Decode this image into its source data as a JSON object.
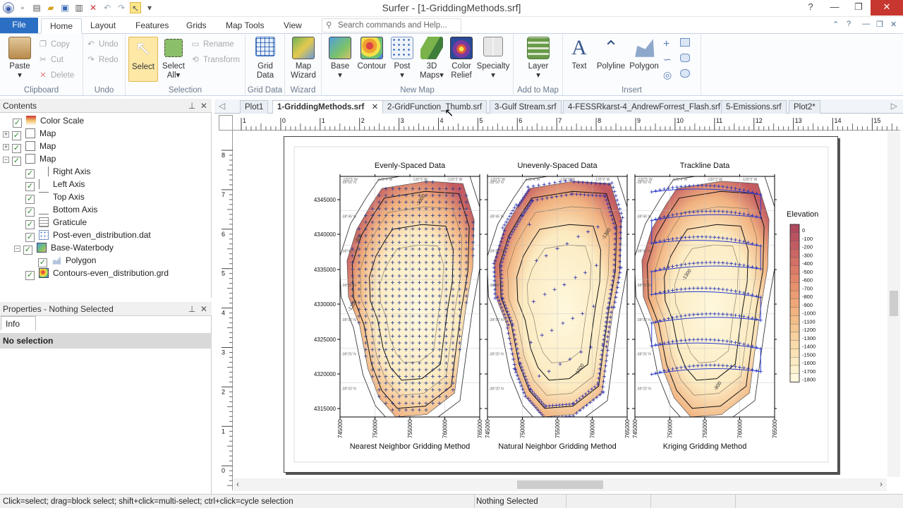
{
  "window": {
    "title": "Surfer - [1-GriddingMethods.srf]"
  },
  "ribbon_tabs": [
    "File",
    "Home",
    "Layout",
    "Features",
    "Grids",
    "Map Tools",
    "View"
  ],
  "search": {
    "placeholder": "Search commands and Help..."
  },
  "clipboard": {
    "paste": "Paste",
    "copy": "Copy",
    "cut": "Cut",
    "delete": "Delete",
    "group": "Clipboard"
  },
  "undo": {
    "undo": "Undo",
    "redo": "Redo",
    "group": "Undo"
  },
  "selection": {
    "select": "Select",
    "select_all_1": "Select",
    "select_all_2": "All",
    "rename": "Rename",
    "transform": "Transform",
    "group": "Selection"
  },
  "grid_data": {
    "label_1": "Grid",
    "label_2": "Data",
    "group": "Grid Data"
  },
  "wizard": {
    "label_1": "Map",
    "label_2": "Wizard",
    "group": "Wizard"
  },
  "new_map": {
    "base": "Base",
    "contour": "Contour",
    "post": "Post",
    "maps3d_1": "3D",
    "maps3d_2": "Maps",
    "relief_1": "Color",
    "relief_2": "Relief",
    "specialty": "Specialty",
    "group": "New Map"
  },
  "add_to_map": {
    "layer": "Layer",
    "group": "Add to Map"
  },
  "insert": {
    "text": "Text",
    "polyline": "Polyline",
    "polygon": "Polygon",
    "group": "Insert"
  },
  "contents_panel": {
    "title": "Contents",
    "items": [
      {
        "label": "Color Scale",
        "checked": true,
        "icon": "color-scale-icon"
      },
      {
        "label": "Map",
        "checked": true,
        "icon": "map-icon"
      },
      {
        "label": "Map",
        "checked": true,
        "icon": "map-icon"
      },
      {
        "label": "Map",
        "checked": true,
        "icon": "map-icon"
      },
      {
        "label": "Right Axis",
        "checked": true,
        "icon": "axis-icon"
      },
      {
        "label": "Left Axis",
        "checked": true,
        "icon": "axis-icon"
      },
      {
        "label": "Top Axis",
        "checked": true,
        "icon": "axis-icon"
      },
      {
        "label": "Bottom Axis",
        "checked": true,
        "icon": "axis-icon"
      },
      {
        "label": "Graticule",
        "checked": true,
        "icon": "graticule-icon"
      },
      {
        "label": "Post-even_distribution.dat",
        "checked": true,
        "icon": "post-layer-icon"
      },
      {
        "label": "Base-Waterbody",
        "checked": true,
        "icon": "base-layer-icon"
      },
      {
        "label": "Polygon",
        "checked": true,
        "icon": "polygon-icon"
      },
      {
        "label": "Contours-even_distribution.grd",
        "checked": true,
        "icon": "contour-layer-icon"
      }
    ]
  },
  "properties_panel": {
    "title": "Properties - Nothing Selected",
    "tab": "Info",
    "selection": "No selection"
  },
  "document_tabs": [
    "Plot1",
    "1-GriddingMethods.srf",
    "2-GridFunction_Thumb.srf",
    "3-Gulf Stream.srf",
    "4-FESSRkarst-4_AndrewForrest_Flash.srf",
    "5-Emissions.srf",
    "Plot2*"
  ],
  "ruler": {
    "top_labels": [
      "1",
      "0",
      "1",
      "2",
      "3",
      "4",
      "5",
      "6",
      "7",
      "8",
      "9",
      "10",
      "11",
      "12",
      "13",
      "14",
      "15"
    ],
    "left_labels": [
      "8",
      "7",
      "6",
      "5",
      "4",
      "3",
      "2",
      "1",
      "0"
    ]
  },
  "figure": {
    "maps": [
      {
        "title": "Evenly-Spaced Data",
        "method": "Nearest Neighbor Gridding Method"
      },
      {
        "title": "Unevenly-Spaced Data",
        "method": "Natural Neighbor Gridding Method"
      },
      {
        "title": "Trackline Data",
        "method": "Kriging Gridding Method"
      }
    ],
    "y_ticks": [
      "4345000",
      "4340000",
      "4335000",
      "4330000",
      "4325000",
      "4320000",
      "4315000"
    ],
    "x_ticks": [
      "745000",
      "750000",
      "755000",
      "760000",
      "765000"
    ],
    "contour_labels": [
      "-800",
      "-1200",
      "-1300",
      "-1300",
      "-1500",
      "-1300",
      "-800"
    ],
    "legend": {
      "title": "Elevation",
      "levels": [
        "0",
        "-100",
        "-200",
        "-300",
        "-400",
        "-500",
        "-600",
        "-700",
        "-800",
        "-900",
        "-1000",
        "-1100",
        "-1200",
        "-1300",
        "-1400",
        "-1500",
        "-1600",
        "-1700",
        "-1800"
      ],
      "colors": [
        "#b04a5e",
        "#ba5260",
        "#c35c62",
        "#cc6664",
        "#d47066",
        "#dc7b68",
        "#e2866a",
        "#e8916d",
        "#ec9c72",
        "#efa778",
        "#f1b280",
        "#f3bd89",
        "#f5c793",
        "#f7d19e",
        "#f9daa9",
        "#fae2b5",
        "#fcebc2",
        "#fdf2cf",
        "#fef8de"
      ]
    }
  },
  "status_bar": {
    "hint": "Click=select; drag=block select; shift+click=multi-select; ctrl+click=cycle selection",
    "selection": "Nothing Selected"
  }
}
